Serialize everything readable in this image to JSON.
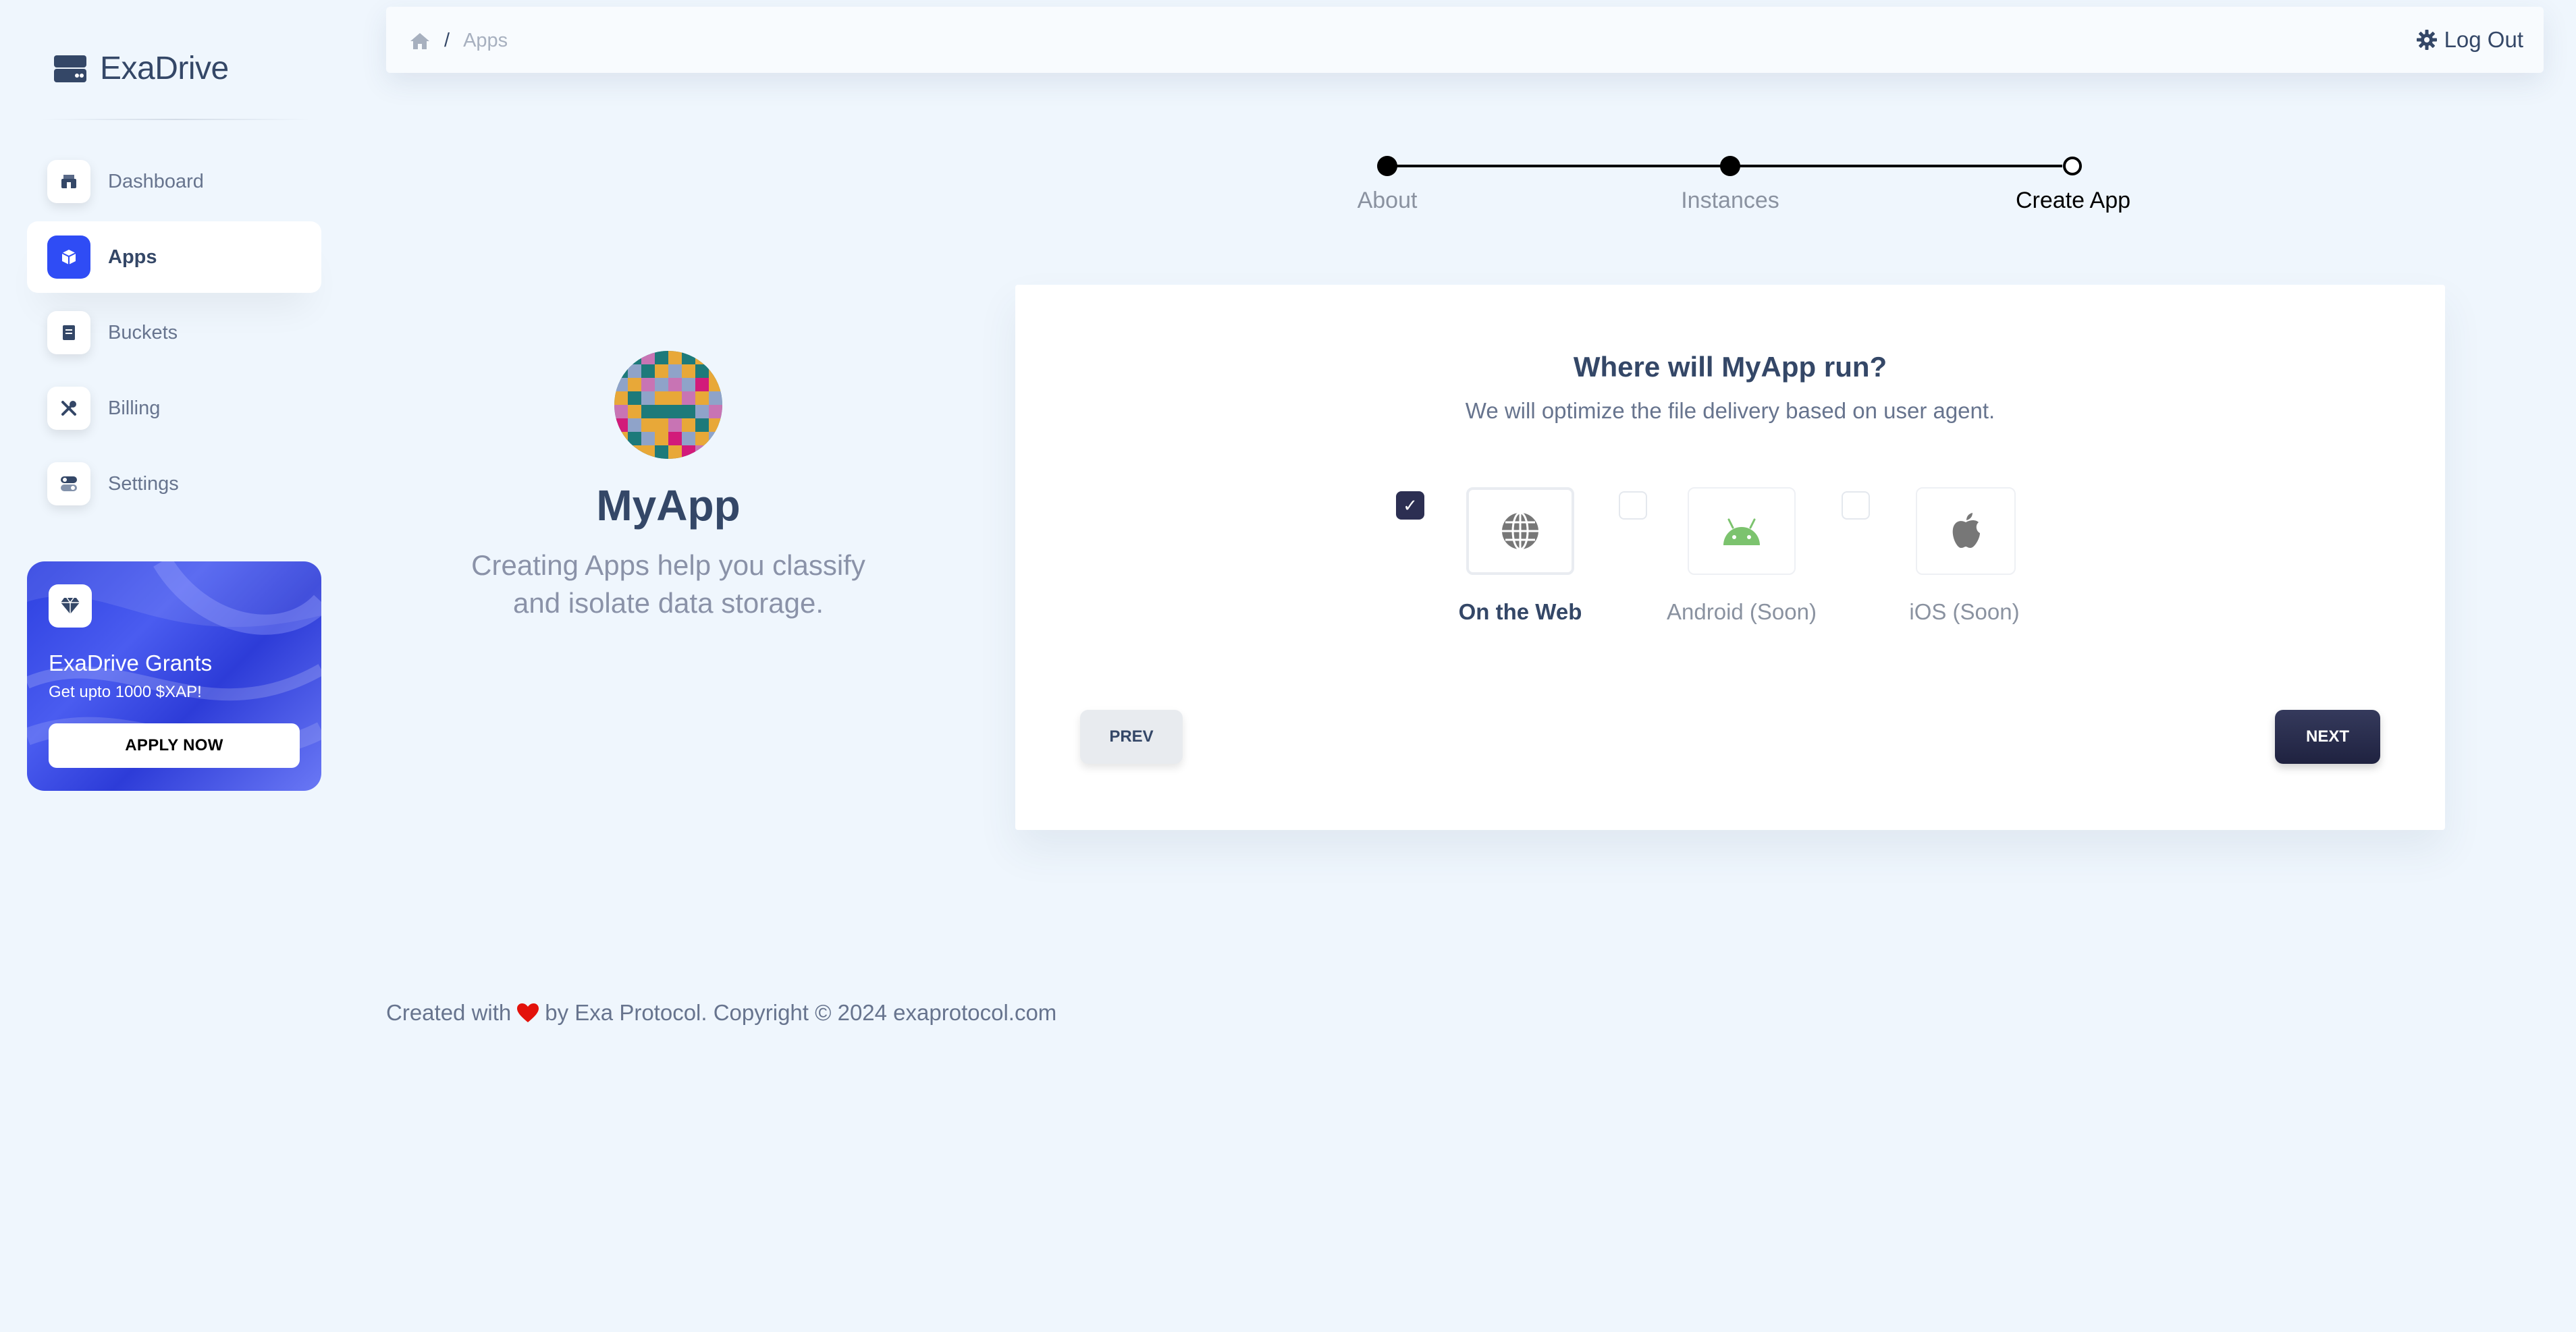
{
  "brand": {
    "name": "ExaDrive"
  },
  "sidebar": {
    "items": [
      {
        "label": "Dashboard",
        "icon": "shop-icon",
        "active": false
      },
      {
        "label": "Apps",
        "icon": "box-icon",
        "active": true
      },
      {
        "label": "Buckets",
        "icon": "document-icon",
        "active": false
      },
      {
        "label": "Billing",
        "icon": "tools-icon",
        "active": false
      },
      {
        "label": "Settings",
        "icon": "toggle-icon",
        "active": false
      }
    ],
    "promo": {
      "title": "ExaDrive Grants",
      "subtitle": "Get upto 1000 $XAP!",
      "button": "APPLY NOW",
      "icon": "diamond-icon"
    }
  },
  "header": {
    "breadcrumb": {
      "sep": "/",
      "current": "Apps"
    },
    "logout": "Log Out"
  },
  "stepper": {
    "steps": [
      {
        "label": "About",
        "done": true
      },
      {
        "label": "Instances",
        "done": true
      },
      {
        "label": "Create App",
        "done": false,
        "current": true
      }
    ]
  },
  "app": {
    "name": "MyApp",
    "description": "Creating Apps help you classify and isolate data storage."
  },
  "card": {
    "title": "Where will MyApp run?",
    "subtitle": "We will optimize the file delivery based on user agent.",
    "options": [
      {
        "label": "On the Web",
        "checked": true,
        "icon": "globe-icon",
        "check_mark": "✓"
      },
      {
        "label": "Android (Soon)",
        "checked": false,
        "icon": "android-icon"
      },
      {
        "label": "iOS (Soon)",
        "checked": false,
        "icon": "apple-icon"
      }
    ],
    "prev": "PREV",
    "next": "NEXT"
  },
  "footer": {
    "before": "Created with",
    "after": "by Exa Protocol. Copyright © 2024 exaprotocol.com"
  },
  "colors": {
    "background": "#eff6fd",
    "accent": "#2f4cf5",
    "dark": "#2c2f52",
    "heart": "#e3120b",
    "android": "#7cc36e"
  }
}
